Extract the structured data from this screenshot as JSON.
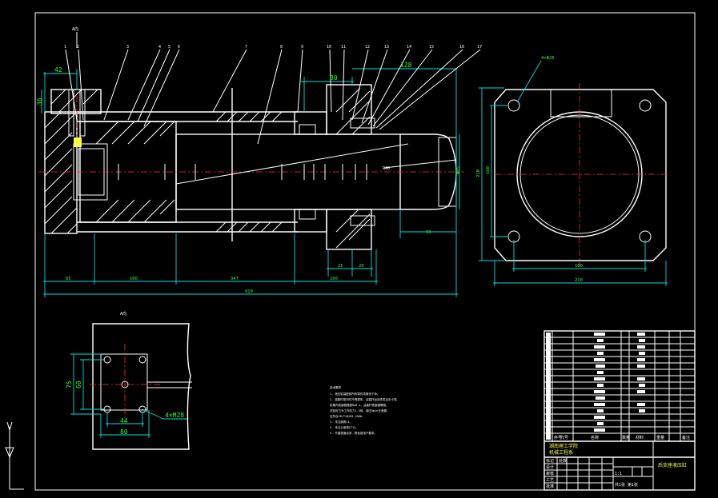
{
  "view_labels": {
    "detail_label": "A向",
    "callout_rod": "R40",
    "callout_holes_right": "4×Φ26",
    "callout_holes_bottom": "4×M28"
  },
  "dimensions": {
    "top_left": "42",
    "left_vertical": "36",
    "top_mid": "80",
    "top_right": "128",
    "rod_extension": "93",
    "flange_a": "25",
    "flange_b": "20",
    "rod_height": "Φ85",
    "bottom_segments": [
      "65",
      "100",
      "347",
      "",
      "100"
    ],
    "overall": "910",
    "right_view_height_outer": "210",
    "right_view_height_inner": "160",
    "right_view_width_inner": "160",
    "right_view_width_outer": "210",
    "detail_h_outer": "75",
    "detail_h_inner": "60",
    "detail_w_inner": "44",
    "detail_w_outer": "80"
  },
  "balloons": [
    "1",
    "2",
    "3",
    "4",
    "5",
    "6",
    "7",
    "8",
    "9",
    "10",
    "11",
    "12",
    "13",
    "14",
    "15",
    "16",
    "17"
  ],
  "notes": {
    "heading": "技术要求",
    "lines": [
      "1. 液压缸装配前所有零件须清洗干净。",
      "2. 装配时密封件不得损伤，活塞杆运动须灵活无卡滞。",
      "   缸筒内表面粗糙度Ra0.4，活塞杆表面镀硬铬。",
      "   试验压力为工作压力1.5倍，保压5min无泄漏。",
      "   应符合JB/T10205-2000。",
      "3. 未注倒角C1。",
      "4. 未注公差按IT12。",
      "5. 外露表面涂漆，颜色按用户要求。"
    ]
  },
  "title_block": {
    "header_cols": [
      "序号",
      "代号",
      "名称",
      "数量",
      "材料",
      "重量",
      "备注"
    ],
    "school": "湖南理工学院",
    "school_sub": "机械工程系",
    "drawing_title": "后支座液压缸",
    "scale": "1:1",
    "sheet": "共1张 第1张",
    "row_labels": [
      "标记",
      "处数",
      "设计",
      "审核",
      "工艺",
      "批准"
    ]
  }
}
